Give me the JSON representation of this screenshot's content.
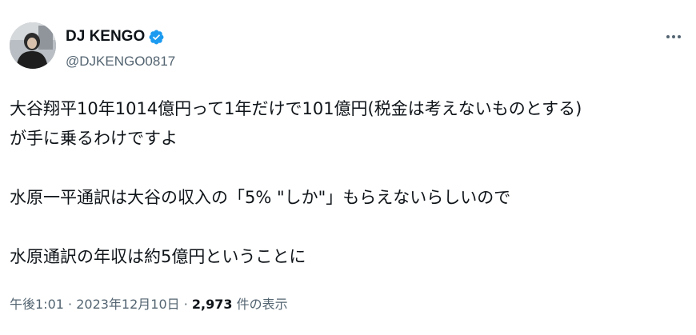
{
  "author": {
    "display_name": "DJ KENGO",
    "handle": "@DJKENGO0817",
    "verified": true
  },
  "tweet": {
    "lines": [
      "大谷翔平10年1014億円って1年だけで101億円(税金は考えないものとする)",
      "が手に乗るわけですよ",
      "",
      "水原一平通訳は大谷の収入の「5% \"しか\"」もらえないらしいので",
      "",
      "水原通訳の年収は約5億円ということに"
    ]
  },
  "meta": {
    "time": "午後1:01",
    "separator1": " · ",
    "date": "2023年12月10日",
    "separator2": " · ",
    "views_count": "2,973",
    "views_label": " 件の表示"
  },
  "colors": {
    "text": "#0f1419",
    "secondary": "#536471",
    "verified": "#1d9bf0"
  },
  "icons": {
    "verified": "verified-badge-icon",
    "more": "more-options-icon"
  }
}
